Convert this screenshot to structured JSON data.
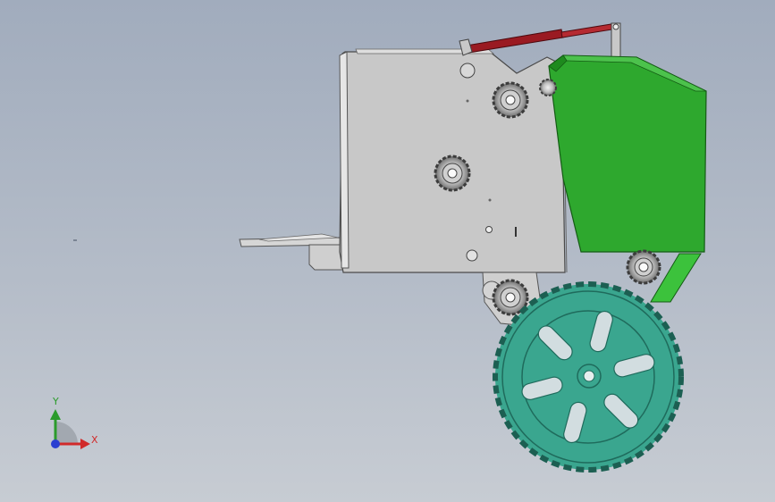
{
  "viewport": {
    "background_top": "#a1acbd",
    "background_bottom": "#c7ccd3"
  },
  "model": {
    "frame_color": "#c8c8c8",
    "hood_color": "#2ea82e",
    "wheel_color": "#3aa68f",
    "cylinder_color": "#9a1a22",
    "gear_color": "#8a8a8a"
  },
  "triad": {
    "x_label": "X",
    "y_label": "Y",
    "x_color": "#d12a2a",
    "y_color": "#2b9b2b",
    "z_color": "#2a3fd1"
  }
}
